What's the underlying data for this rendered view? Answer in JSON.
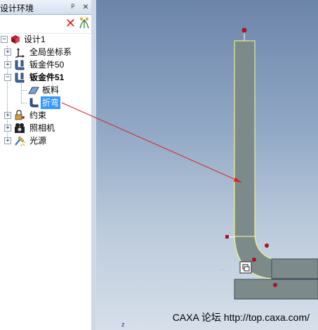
{
  "panel": {
    "title": "设计环境",
    "pin_glyph": "ᵖ",
    "close_glyph": "×",
    "toolbar": {
      "delete_icon": "red-x-icon",
      "tree_icon": "tree-structure-icon"
    }
  },
  "tree": [
    {
      "label": "设计1",
      "icon": "design-root-icon",
      "expander": "−",
      "bold": false
    },
    {
      "label": "全局坐标系",
      "icon": "axes-icon",
      "expander": "+",
      "bold": false
    },
    {
      "label": "钣金件50",
      "icon": "sheetmetal-icon",
      "expander": "+",
      "bold": false
    },
    {
      "label": "钣金件51",
      "icon": "sheetmetal-icon",
      "expander": "−",
      "bold": true
    },
    {
      "label": "板料",
      "icon": "plate-icon",
      "expander": "",
      "bold": false
    },
    {
      "label": "折弯",
      "icon": "bend-icon",
      "expander": "",
      "bold": false,
      "selected": true
    },
    {
      "label": "约束",
      "icon": "constraint-icon",
      "expander": "+",
      "bold": false
    },
    {
      "label": "照相机",
      "icon": "camera-icon",
      "expander": "+",
      "bold": false
    },
    {
      "label": "光源",
      "icon": "light-icon",
      "expander": "+",
      "bold": false
    }
  ],
  "viewport": {
    "axis_label": "z",
    "watermark": "CAXA 论坛 http://top.caxa.com/",
    "colors": {
      "part_fill": "#7c8b8a",
      "highlight": "#ffff80",
      "handle": "#b01020",
      "arrow": "#e02020"
    }
  }
}
